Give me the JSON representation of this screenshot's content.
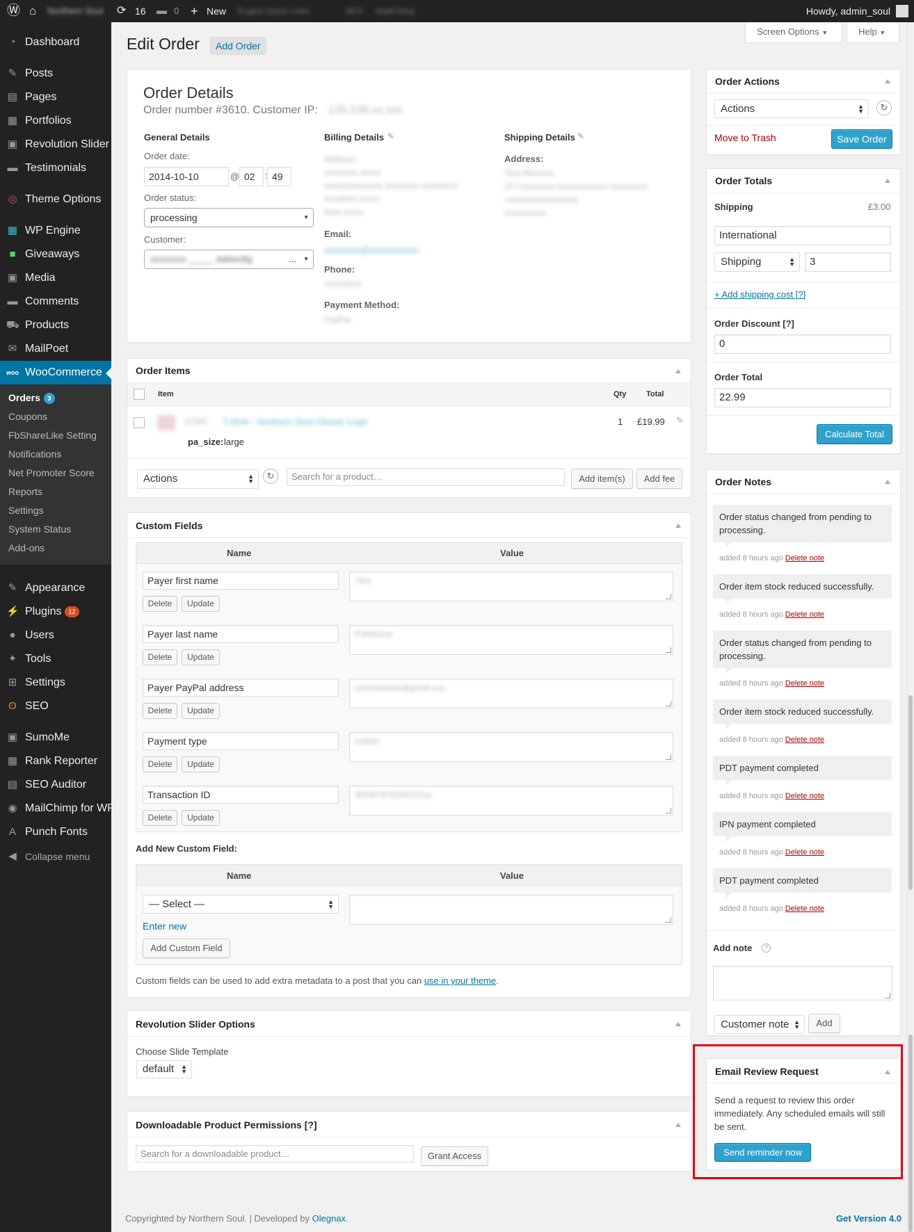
{
  "admin_bar": {
    "site_name": "Northern Soul",
    "updates_count": "16",
    "comments_count": "0",
    "new_label": "New",
    "extra_1": "Engine Quick Links",
    "extra_2": "SEO",
    "extra_3": "MailChimp",
    "howdy": "Howdy, admin_soul"
  },
  "sidebar": {
    "items": [
      {
        "label": "Dashboard",
        "icon": "dashboard-icon"
      },
      {
        "label": "Posts",
        "icon": "pin-icon"
      },
      {
        "label": "Pages",
        "icon": "pages-icon"
      },
      {
        "label": "Portfolios",
        "icon": "portfolio-icon"
      },
      {
        "label": "Revolution Slider",
        "icon": "slider-icon"
      },
      {
        "label": "Testimonials",
        "icon": "testimonial-icon"
      },
      {
        "label": "Theme Options",
        "icon": "theme-options-icon"
      },
      {
        "label": "WP Engine",
        "icon": "wpengine-icon"
      },
      {
        "label": "Giveaways",
        "icon": "giveaway-icon"
      },
      {
        "label": "Media",
        "icon": "media-icon"
      },
      {
        "label": "Comments",
        "icon": "comment-icon"
      },
      {
        "label": "Products",
        "icon": "products-icon"
      },
      {
        "label": "MailPoet",
        "icon": "mail-icon"
      },
      {
        "label": "WooCommerce",
        "icon": "woo-icon"
      }
    ],
    "woo_sub": [
      {
        "label": "Orders",
        "badge": "3"
      },
      {
        "label": "Coupons"
      },
      {
        "label": "FbShareLike Setting"
      },
      {
        "label": "Notifications"
      },
      {
        "label": "Net Promoter Score"
      },
      {
        "label": "Reports"
      },
      {
        "label": "Settings"
      },
      {
        "label": "System Status"
      },
      {
        "label": "Add-ons"
      }
    ],
    "items2": [
      {
        "label": "Appearance",
        "icon": "brush-icon"
      },
      {
        "label": "Plugins",
        "icon": "plugin-icon",
        "badge": "12"
      },
      {
        "label": "Users",
        "icon": "user-icon"
      },
      {
        "label": "Tools",
        "icon": "wrench-icon"
      },
      {
        "label": "Settings",
        "icon": "settings-icon"
      },
      {
        "label": "SEO",
        "icon": "seo-icon"
      },
      {
        "label": "SumoMe",
        "icon": "sumome-icon"
      },
      {
        "label": "Rank Reporter",
        "icon": "chart-icon"
      },
      {
        "label": "SEO Auditor",
        "icon": "auditor-icon"
      },
      {
        "label": "MailChimp for WP",
        "icon": "mailchimp-icon"
      },
      {
        "label": "Punch Fonts",
        "icon": "font-icon"
      }
    ],
    "collapse": "Collapse menu"
  },
  "top_buttons": {
    "screen_options": "Screen Options",
    "help": "Help"
  },
  "header": {
    "title": "Edit Order",
    "add_order": "Add Order"
  },
  "order_details": {
    "title": "Order Details",
    "subtitle": "Order number #3610. Customer IP:",
    "ip": "135.136.xx.xxx",
    "general_heading": "General Details",
    "order_date_label": "Order date:",
    "order_date": "2014-10-10",
    "at": "@",
    "hour": "02",
    "colon": ":",
    "minute": "49",
    "status_label": "Order status:",
    "status": "processing",
    "customer_label": "Customer:",
    "customer_value": "xxxxxxxx _____ italiandig",
    "customer_ellipsis": "...",
    "billing_heading": "Billing Details",
    "billing_address": [
      "Address:",
      "xxxxxxxx xxxxx",
      "xxxxxxxxxxxxxx xxxxxxxx xxxxxxxxx",
      "Accident xxxxx",
      "New xxxxx"
    ],
    "email_label": "Email:",
    "email_value": "xxxxxxxx@xxxxxxxxxxx",
    "phone_label": "Phone:",
    "phone_value": "xxxxxxxxx",
    "payment_label": "Payment Method:",
    "payment_value": "PayPal",
    "shipping_heading": "Shipping Details",
    "shipping_address_label": "Address:",
    "shipping_address": [
      "Tara Mxxxxxx",
      "15 Cxxxxxxxx xxxxxxxxxxxx xxxxxxxxx",
      "xxxxxxxxxxxxxxxxx)",
      "xxxxxxxxxx"
    ]
  },
  "order_items": {
    "title": "Order Items",
    "col_item": "Item",
    "col_qty": "Qty",
    "col_total": "Total",
    "rows": [
      {
        "name": "T-Shirt - Northern Soul Classic Logo",
        "sku": "12345",
        "meta_key": "pa_size:",
        "meta_value": "large",
        "qty": "1",
        "total": "£19.99"
      }
    ],
    "actions_select": "Actions",
    "search_placeholder": "Search for a product…",
    "add_items": "Add item(s)",
    "add_fee": "Add fee"
  },
  "custom_fields": {
    "title": "Custom Fields",
    "col_name": "Name",
    "col_value": "Value",
    "delete": "Delete",
    "update": "Update",
    "rows": [
      {
        "name": "Payer first name",
        "value": "Tara"
      },
      {
        "name": "Payer last name",
        "value": "Fothekxxx"
      },
      {
        "name": "Payer PayPal address",
        "value": "xxxxmatarax@gmail.xxx"
      },
      {
        "name": "Payment type",
        "value": "instant"
      },
      {
        "name": "Transaction ID",
        "value": "4DG67678156101xx"
      }
    ],
    "add_new_label": "Add New Custom Field:",
    "select_placeholder": "— Select —",
    "enter_new": "Enter new",
    "add_button": "Add Custom Field",
    "footer_text": "Custom fields can be used to add extra metadata to a post that you can",
    "footer_link": "use in your theme",
    "footer_period": "."
  },
  "rev_slider": {
    "title": "Revolution Slider Options",
    "label": "Choose Slide Template",
    "value": "default"
  },
  "downloadable": {
    "title": "Downloadable Product Permissions [?]",
    "placeholder": "Search for a downloadable product…",
    "grant": "Grant Access"
  },
  "footer": {
    "text": "Copyrighted by Northern Soul. | Developed by",
    "link": "Olegnax",
    "period": ".",
    "version": "Get Version 4.0"
  },
  "order_actions": {
    "title": "Order Actions",
    "select": "Actions",
    "trash": "Move to Trash",
    "save": "Save Order"
  },
  "order_totals": {
    "title": "Order Totals",
    "shipping_label": "Shipping",
    "shipping_amount": "£3.00",
    "shipping_name": "International",
    "shipping_method": "Shipping",
    "shipping_cost": "3",
    "add_shipping": "+ Add shipping cost [?]",
    "discount_label": "Order Discount [?]",
    "discount": "0",
    "total_label": "Order Total",
    "total": "22.99",
    "calc_button": "Calculate Total"
  },
  "order_notes": {
    "title": "Order Notes",
    "notes": [
      {
        "text": "Order status changed from pending to processing.",
        "meta": "added 8 hours ago"
      },
      {
        "text": "Order item stock reduced successfully.",
        "meta": "added 8 hours ago"
      },
      {
        "text": "Order status changed from pending to processing.",
        "meta": "added 8 hours ago"
      },
      {
        "text": "Order item stock reduced successfully.",
        "meta": "added 8 hours ago"
      },
      {
        "text": "PDT payment completed",
        "meta": "added 8 hours ago"
      },
      {
        "text": "IPN payment completed",
        "meta": "added 8 hours ago"
      },
      {
        "text": "PDT payment completed",
        "meta": "added 8 hours ago"
      }
    ],
    "delete_label": "Delete note",
    "add_note_label": "Add note",
    "help_icon": "?",
    "note_type": "Customer note",
    "add_button": "Add"
  },
  "email_review": {
    "title": "Email Review Request",
    "text": "Send a request to review this order immediately. Any scheduled emails will still be sent.",
    "button": "Send reminder now",
    "highlight_color": "#e3000f"
  },
  "colors": {
    "accent": "#0074a2",
    "button_primary": "#2ea2cc",
    "link": "#0074a2",
    "danger": "#a00",
    "admin_dark": "#222"
  }
}
